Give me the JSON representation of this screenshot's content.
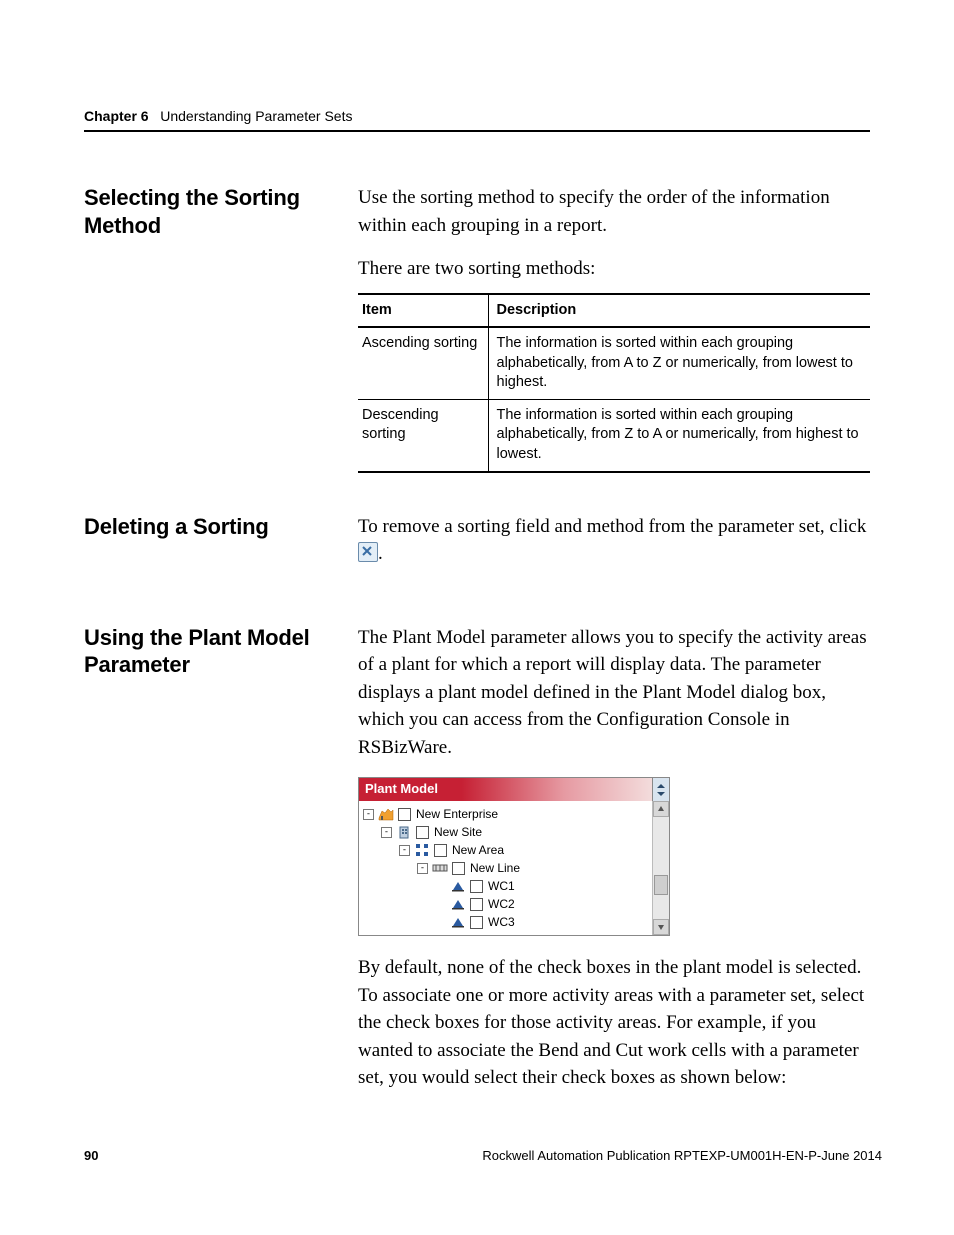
{
  "header": {
    "chapter_label": "Chapter 6",
    "chapter_title": "Understanding Parameter Sets"
  },
  "section_sorting_method": {
    "heading": "Selecting the Sorting Method",
    "para1": "Use the sorting method to specify the order of the information within each grouping in a report.",
    "para2": "There are two sorting methods:",
    "table": {
      "col1": "Item",
      "col2": "Description",
      "rows": [
        {
          "item": "Ascending sorting",
          "desc": "The information is sorted within each grouping alphabetically, from A to Z or numerically, from lowest to highest."
        },
        {
          "item": "Descending sorting",
          "desc": "The information is sorted within each grouping alphabetically, from Z to A or numerically, from highest to lowest."
        }
      ]
    }
  },
  "section_deleting_sorting": {
    "heading": "Deleting a Sorting",
    "para_prefix": "To remove a sorting field and method from the parameter set, click ",
    "icon_name": "delete-x-icon",
    "para_suffix": "."
  },
  "section_plant_model": {
    "heading": "Using the Plant Model Parameter",
    "para1": "The Plant Model parameter allows you to specify the activity areas of a plant for which a report will display data. The parameter displays a plant model defined in the Plant Model dialog box, which you can access from the Configuration Console in RSBizWare.",
    "panel": {
      "title": "Plant Model",
      "nodes": [
        {
          "level": 0,
          "expander": "-",
          "icon": "enterprise",
          "label": "New Enterprise"
        },
        {
          "level": 1,
          "expander": "-",
          "icon": "site",
          "label": "New Site"
        },
        {
          "level": 2,
          "expander": "-",
          "icon": "area",
          "label": "New Area"
        },
        {
          "level": 3,
          "expander": "-",
          "icon": "line",
          "label": "New Line"
        },
        {
          "level": 4,
          "expander": "",
          "icon": "wc",
          "label": "WC1"
        },
        {
          "level": 4,
          "expander": "",
          "icon": "wc",
          "label": "WC2"
        },
        {
          "level": 4,
          "expander": "",
          "icon": "wc",
          "label": "WC3"
        }
      ]
    },
    "para2": "By default, none of the check boxes in the plant model is selected. To associate one or more activity areas with a parameter set, select the check boxes for those activity areas. For example, if you wanted to associate the Bend and Cut work cells with a parameter set, you would select their check boxes as shown below:"
  },
  "footer": {
    "page_number": "90",
    "publication": "Rockwell Automation Publication RPTEXP-UM001H-EN-P-June 2014"
  }
}
